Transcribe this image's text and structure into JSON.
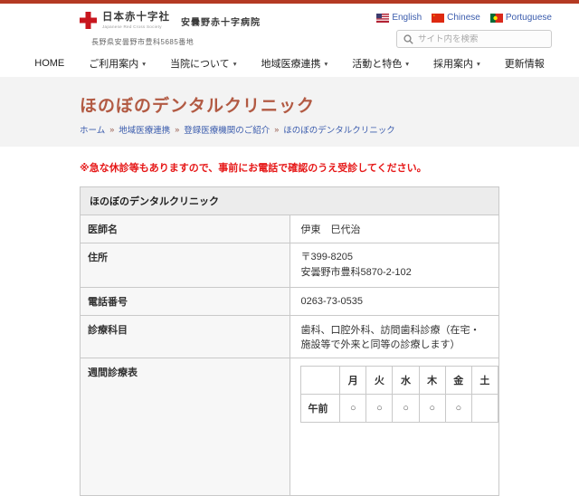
{
  "colors": {
    "top_bar": "#b43a23",
    "cross_red": "#c8161e",
    "link_blue": "#3b5cad",
    "title_terracotta": "#b25a43",
    "notice_red": "#e61717",
    "title_band_bg": "#f3f3f3",
    "table_header_bg": "#ececec"
  },
  "icons": {
    "dropdown_caret": "▾"
  },
  "header": {
    "org_name": "日本赤十字社",
    "org_name_en": "Japanese Red Cross Society",
    "hospital_name": "安曇野赤十字病院",
    "address": "長野県安曇野市豊科5685番地",
    "languages": [
      {
        "label": "English"
      },
      {
        "label": "Chinese"
      },
      {
        "label": "Portuguese"
      }
    ],
    "search_placeholder": "サイト内を検索"
  },
  "nav": {
    "items": [
      {
        "label": "HOME",
        "has_dropdown": false
      },
      {
        "label": "ご利用案内",
        "has_dropdown": true
      },
      {
        "label": "当院について",
        "has_dropdown": true
      },
      {
        "label": "地域医療連携",
        "has_dropdown": true
      },
      {
        "label": "活動と特色",
        "has_dropdown": true
      },
      {
        "label": "採用案内",
        "has_dropdown": true
      },
      {
        "label": "更新情報",
        "has_dropdown": false
      }
    ]
  },
  "page": {
    "title": "ほのぼのデンタルクリニック",
    "breadcrumb": {
      "separator": "»",
      "items": [
        "ホーム",
        "地域医療連携",
        "登録医療機関のご紹介",
        "ほのぼのデンタルクリニック"
      ]
    }
  },
  "content": {
    "notice": "※急な休診等もありますので、事前にお電話で確認のうえ受診してください。",
    "clinic_table": {
      "header": "ほのぼのデンタルクリニック",
      "rows": {
        "doctor": {
          "label": "医師名",
          "value": "伊東　巳代治"
        },
        "address": {
          "label": "住所",
          "line1": "〒399-8205",
          "line2": "安曇野市豊科5870-2-102"
        },
        "phone": {
          "label": "電話番号",
          "value": "0263-73-0535"
        },
        "departments": {
          "label": "診療科目",
          "value": "歯科、口腔外科、訪問歯科診療（在宅・施設等で外来と同等の診療します）"
        },
        "schedule": {
          "label": "週間診療表"
        }
      },
      "schedule": {
        "day_headers": [
          "",
          "月",
          "火",
          "水",
          "木",
          "金",
          "土"
        ],
        "rows": [
          {
            "label": "午前",
            "values": [
              "○",
              "○",
              "○",
              "○",
              "○",
              ""
            ]
          }
        ]
      }
    }
  }
}
